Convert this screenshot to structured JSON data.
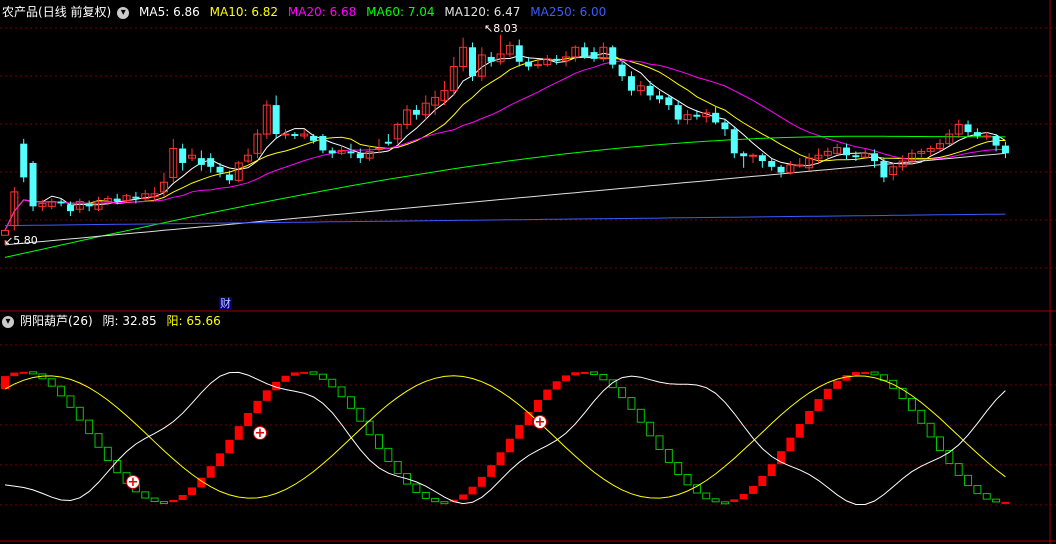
{
  "top_panel": {
    "stock_name": "农产品",
    "mode": "(日线 前复权)",
    "indicators": [
      {
        "label": "MA5: 6.86",
        "color": "#ffffff"
      },
      {
        "label": "MA10: 6.82",
        "color": "#ffff00"
      },
      {
        "label": "MA20: 6.68",
        "color": "#ff00ff"
      },
      {
        "label": "MA60: 7.04",
        "color": "#00ff00"
      },
      {
        "label": "MA120: 6.47",
        "color": "#e0e0e0"
      },
      {
        "label": "MA250: 6.00",
        "color": "#3b5bff"
      }
    ],
    "high_label": "8.03",
    "low_label": "5.80",
    "finance_marker": "财"
  },
  "bottom_panel": {
    "name": "阴阳葫芦(26)",
    "yin_label": "阴: 32.85",
    "yang_label": "阳: 65.66",
    "yin_color": "#ffffff",
    "yang_color": "#ffff00"
  },
  "colors": {
    "up": "#ff3232",
    "down": "#54ffff",
    "grid": "#800000",
    "green": "#00c800",
    "red": "#ff0000"
  },
  "chart_data": {
    "type": "candlestick",
    "candles": [
      [
        5.95,
        6.0,
        5.9,
        5.85
      ],
      [
        6.05,
        6.4,
        6.45,
        6.0
      ],
      [
        6.9,
        6.55,
        6.95,
        6.5
      ],
      [
        6.7,
        6.25,
        6.72,
        6.2
      ],
      [
        6.25,
        6.28,
        6.32,
        6.2
      ],
      [
        6.25,
        6.3,
        6.33,
        6.22
      ],
      [
        6.3,
        6.28,
        6.33,
        6.25
      ],
      [
        6.27,
        6.2,
        6.3,
        6.15
      ],
      [
        6.22,
        6.3,
        6.33,
        6.18
      ],
      [
        6.28,
        6.25,
        6.31,
        6.2
      ],
      [
        6.22,
        6.3,
        6.35,
        6.2
      ],
      [
        6.3,
        6.33,
        6.36,
        6.26
      ],
      [
        6.33,
        6.3,
        6.38,
        6.27
      ],
      [
        6.31,
        6.36,
        6.38,
        6.29
      ],
      [
        6.35,
        6.33,
        6.4,
        6.28
      ],
      [
        6.33,
        6.38,
        6.42,
        6.3
      ],
      [
        6.35,
        6.38,
        6.45,
        6.3
      ],
      [
        6.4,
        6.5,
        6.6,
        6.35
      ],
      [
        6.55,
        6.85,
        6.95,
        6.5
      ],
      [
        6.85,
        6.7,
        6.9,
        6.62
      ],
      [
        6.75,
        6.78,
        6.85,
        6.72
      ],
      [
        6.75,
        6.68,
        6.83,
        6.62
      ],
      [
        6.75,
        6.66,
        6.8,
        6.6
      ],
      [
        6.66,
        6.6,
        6.7,
        6.55
      ],
      [
        6.58,
        6.52,
        6.62,
        6.48
      ],
      [
        6.52,
        6.7,
        6.72,
        6.5
      ],
      [
        6.72,
        6.78,
        6.85,
        6.7
      ],
      [
        6.8,
        7.0,
        7.05,
        6.75
      ],
      [
        7.0,
        7.3,
        7.35,
        6.95
      ],
      [
        7.3,
        7.0,
        7.4,
        6.95
      ],
      [
        7.0,
        7.0,
        7.05,
        6.95
      ],
      [
        7.0,
        6.98,
        7.02,
        6.95
      ],
      [
        6.98,
        7.0,
        7.05,
        6.95
      ],
      [
        6.98,
        6.93,
        7.0,
        6.9
      ],
      [
        6.98,
        6.83,
        7.0,
        6.8
      ],
      [
        6.83,
        6.8,
        6.86,
        6.75
      ],
      [
        6.8,
        6.83,
        6.88,
        6.78
      ],
      [
        6.82,
        6.8,
        6.9,
        6.75
      ],
      [
        6.8,
        6.75,
        6.85,
        6.7
      ],
      [
        6.75,
        6.82,
        6.88,
        6.72
      ],
      [
        6.85,
        6.85,
        6.95,
        6.8
      ],
      [
        6.92,
        6.9,
        7.0,
        6.88
      ],
      [
        6.95,
        7.1,
        7.12,
        6.9
      ],
      [
        7.1,
        7.25,
        7.3,
        7.05
      ],
      [
        7.25,
        7.2,
        7.3,
        7.15
      ],
      [
        7.2,
        7.32,
        7.4,
        7.15
      ],
      [
        7.3,
        7.38,
        7.45,
        7.2
      ],
      [
        7.35,
        7.45,
        7.55,
        7.3
      ],
      [
        7.45,
        7.7,
        7.8,
        7.4
      ],
      [
        7.7,
        7.9,
        8.0,
        7.65
      ],
      [
        7.9,
        7.6,
        7.95,
        7.55
      ],
      [
        7.6,
        7.82,
        7.9,
        7.55
      ],
      [
        7.8,
        7.75,
        7.85,
        7.7
      ],
      [
        7.75,
        7.83,
        8.03,
        7.72
      ],
      [
        7.83,
        7.92,
        7.96,
        7.8
      ],
      [
        7.92,
        7.75,
        7.98,
        7.7
      ],
      [
        7.75,
        7.7,
        7.8,
        7.66
      ],
      [
        7.72,
        7.72,
        7.78,
        7.68
      ],
      [
        7.72,
        7.78,
        7.82,
        7.7
      ],
      [
        7.78,
        7.76,
        7.82,
        7.72
      ],
      [
        7.76,
        7.8,
        7.86,
        7.7
      ],
      [
        7.8,
        7.9,
        7.92,
        7.75
      ],
      [
        7.9,
        7.8,
        7.95,
        7.78
      ],
      [
        7.85,
        7.78,
        7.9,
        7.75
      ],
      [
        7.78,
        7.9,
        7.95,
        7.75
      ],
      [
        7.9,
        7.72,
        7.92,
        7.68
      ],
      [
        7.72,
        7.6,
        7.75,
        7.55
      ],
      [
        7.6,
        7.45,
        7.65,
        7.4
      ],
      [
        7.45,
        7.5,
        7.55,
        7.4
      ],
      [
        7.5,
        7.4,
        7.55,
        7.35
      ],
      [
        7.4,
        7.36,
        7.45,
        7.32
      ],
      [
        7.38,
        7.3,
        7.4,
        7.25
      ],
      [
        7.3,
        7.15,
        7.35,
        7.1
      ],
      [
        7.15,
        7.2,
        7.25,
        7.1
      ],
      [
        7.2,
        7.18,
        7.25,
        7.15
      ],
      [
        7.18,
        7.22,
        7.26,
        7.12
      ],
      [
        7.22,
        7.12,
        7.28,
        7.1
      ],
      [
        7.12,
        7.05,
        7.15,
        6.98
      ],
      [
        7.05,
        6.8,
        7.08,
        6.75
      ],
      [
        6.8,
        6.77,
        6.82,
        6.65
      ],
      [
        6.77,
        6.78,
        6.8,
        6.7
      ],
      [
        6.78,
        6.72,
        6.8,
        6.65
      ],
      [
        6.72,
        6.66,
        6.75,
        6.62
      ],
      [
        6.66,
        6.6,
        6.68,
        6.55
      ],
      [
        6.6,
        6.68,
        6.72,
        6.58
      ],
      [
        6.68,
        6.68,
        6.75,
        6.65
      ],
      [
        6.65,
        6.75,
        6.8,
        6.62
      ],
      [
        6.75,
        6.78,
        6.85,
        6.7
      ],
      [
        6.78,
        6.82,
        6.86,
        6.75
      ],
      [
        6.8,
        6.86,
        6.9,
        6.78
      ],
      [
        6.86,
        6.78,
        6.9,
        6.74
      ],
      [
        6.78,
        6.76,
        6.82,
        6.72
      ],
      [
        6.76,
        6.8,
        6.85,
        6.74
      ],
      [
        6.8,
        6.72,
        6.84,
        6.65
      ],
      [
        6.72,
        6.55,
        6.75,
        6.5
      ],
      [
        6.58,
        6.66,
        6.7,
        6.52
      ],
      [
        6.66,
        6.72,
        6.78,
        6.62
      ],
      [
        6.72,
        6.8,
        6.84,
        6.68
      ],
      [
        6.8,
        6.82,
        6.85,
        6.76
      ],
      [
        6.82,
        6.85,
        6.88,
        6.78
      ],
      [
        6.85,
        6.9,
        6.95,
        6.82
      ],
      [
        6.9,
        7.0,
        7.05,
        6.88
      ],
      [
        7.0,
        7.1,
        7.15,
        6.96
      ],
      [
        7.1,
        7.02,
        7.14,
        6.98
      ],
      [
        7.02,
        6.98,
        7.06,
        6.95
      ],
      [
        6.98,
        6.98,
        7.02,
        6.94
      ],
      [
        6.98,
        6.88,
        7.0,
        6.82
      ],
      [
        6.88,
        6.8,
        6.92,
        6.75
      ]
    ]
  }
}
